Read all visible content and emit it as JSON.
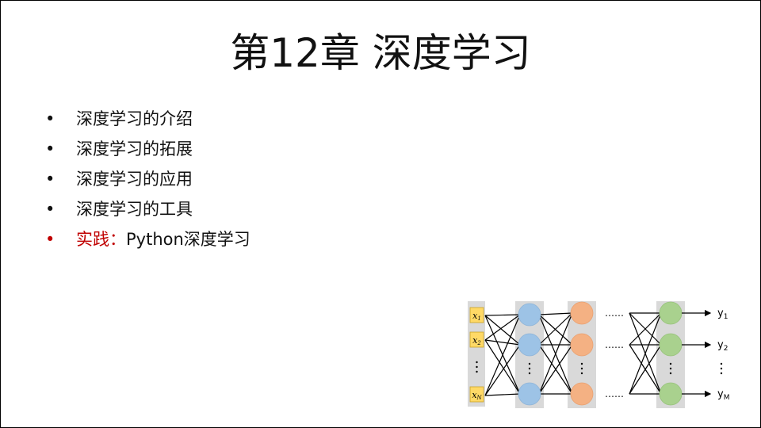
{
  "slide": {
    "title": "第12章 深度学习",
    "bullets": [
      {
        "text": "深度学习的介绍"
      },
      {
        "text": "深度学习的拓展"
      },
      {
        "text": "深度学习的应用"
      },
      {
        "text": "深度学习的工具"
      },
      {
        "prefix": "实践：",
        "text": "Python深度学习"
      }
    ],
    "bullet_symbol": "•",
    "highlight_color": "#c00000"
  },
  "network": {
    "inputs": [
      {
        "base": "x",
        "sub": "1"
      },
      {
        "base": "x",
        "sub": "2"
      },
      {
        "base": "x",
        "sub": "N"
      }
    ],
    "outputs": [
      {
        "base": "y",
        "sub": "1"
      },
      {
        "base": "y",
        "sub": "2"
      },
      {
        "base": "y",
        "sub": "M"
      }
    ],
    "ellipsis": "……",
    "layer_colors": [
      "#9dc3e6",
      "#f4b183",
      "#a9d18e"
    ],
    "input_box_color": "#ffd966",
    "column_bg": "#d9d9d9"
  }
}
